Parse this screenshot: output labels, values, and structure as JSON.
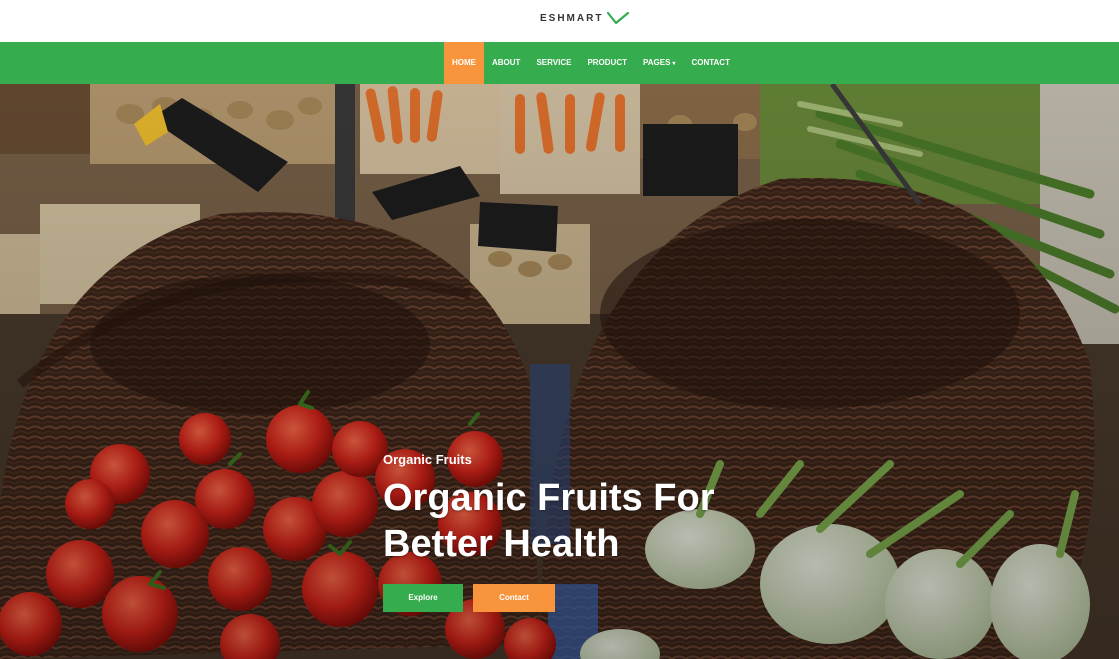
{
  "brand": {
    "name": "ESHMART",
    "logo_icon": "v-checkmark-icon",
    "color_dark": "#333333",
    "color_mark": "#35ac4d"
  },
  "nav": {
    "background": "#35ac4d",
    "active_color": "#f7943c",
    "items": [
      {
        "label": "HOME",
        "active": true
      },
      {
        "label": "ABOUT"
      },
      {
        "label": "SERVICE"
      },
      {
        "label": "PRODUCT"
      },
      {
        "label": "PAGES",
        "has_dropdown": true
      },
      {
        "label": "CONTACT"
      }
    ]
  },
  "hero": {
    "kicker": "Organic Fruits",
    "title": "Organic Fruits For Better Health",
    "buttons": {
      "explore_label": "Explore",
      "contact_label": "Contact"
    },
    "background_image": "market-baskets-tomatoes-fennel"
  }
}
